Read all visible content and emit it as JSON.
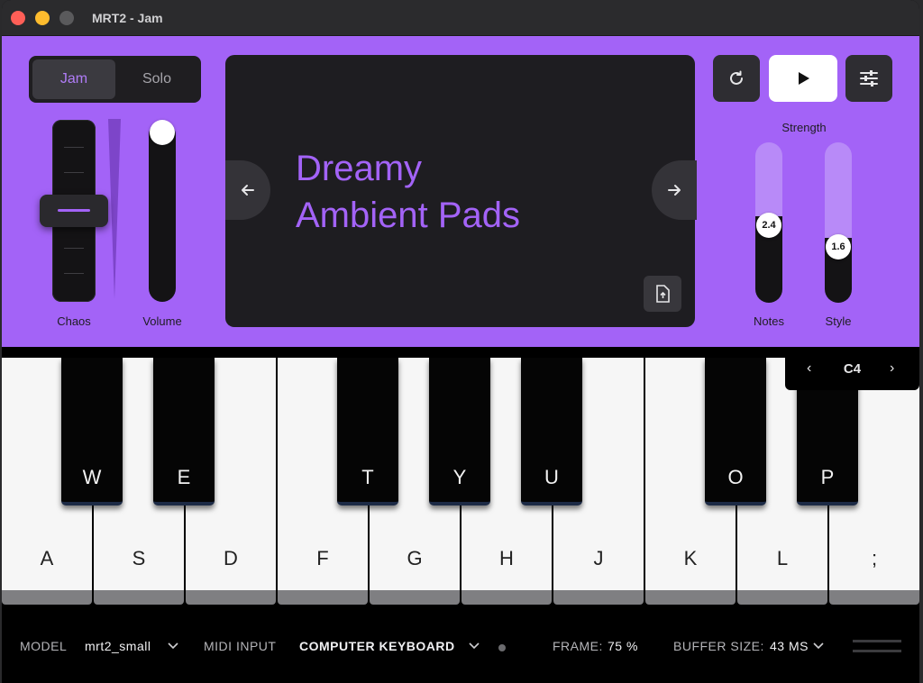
{
  "window": {
    "title": "MRT2 - Jam"
  },
  "mode": {
    "jam_label": "Jam",
    "solo_label": "Solo",
    "selected": "Jam"
  },
  "chaos": {
    "label": "Chaos"
  },
  "volume": {
    "label": "Volume"
  },
  "display": {
    "line1": "Dreamy",
    "line2": "Ambient Pads"
  },
  "strength": {
    "title": "Strength",
    "notes": {
      "label": "Notes",
      "value": "2.4"
    },
    "style": {
      "label": "Style",
      "value": "1.6"
    }
  },
  "keyboard": {
    "white_keys": [
      "A",
      "S",
      "D",
      "F",
      "G",
      "H",
      "J",
      "K",
      "L",
      ";"
    ],
    "black_keys": [
      "W",
      "E",
      "T",
      "Y",
      "U",
      "O",
      "P"
    ],
    "octave": "C4"
  },
  "status": {
    "model_label": "MODEL",
    "model_value": "mrt2_small",
    "midi_label": "MIDI INPUT",
    "midi_value": "COMPUTER KEYBOARD",
    "frame_label": "FRAME:",
    "frame_value": "75 %",
    "buffer_label": "BUFFER SIZE:",
    "buffer_value": "43 MS"
  },
  "colors": {
    "accent": "#a363f7",
    "panel": "#1e1d21"
  }
}
